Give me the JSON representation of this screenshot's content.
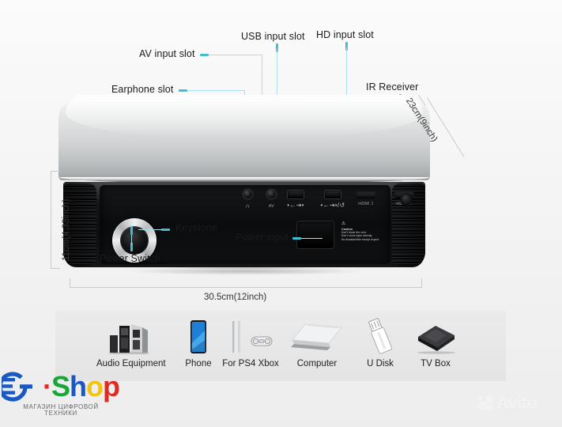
{
  "image": {
    "subject": "Mini LED projector rear/front panel diagram",
    "background_color": "#f4f4f4"
  },
  "callouts": [
    {
      "id": "earphone",
      "label": "Earphone slot",
      "color": "#3fc0d2"
    },
    {
      "id": "av",
      "label": "AV input slot",
      "color": "#3fc0d2"
    },
    {
      "id": "usb",
      "label": "USB input slot",
      "color": "#3fc0d2"
    },
    {
      "id": "hd",
      "label": "HD input slot",
      "color": "#3fc0d2"
    },
    {
      "id": "ir",
      "label": "IR Receiver",
      "color": "#3fc0d2"
    },
    {
      "id": "keystone",
      "label": "Keystone",
      "color": "#3fc0d2"
    },
    {
      "id": "power_switch",
      "label": "Power Switch",
      "color": "#3fc0d2"
    },
    {
      "id": "power_input",
      "label": "Power input",
      "color": "#3fc0d2"
    }
  ],
  "dimensions": {
    "width": "30.5cm(12inch)",
    "height": "11cm(4.33inch)",
    "depth": "23cm(9inch)"
  },
  "ports": [
    {
      "id": "earphone",
      "label": "∩",
      "type": "jack"
    },
    {
      "id": "av",
      "label": "AV",
      "type": "jack"
    },
    {
      "id": "usb1",
      "label": "•←⇥•",
      "type": "usb"
    },
    {
      "id": "usb2",
      "label": "•←⇥•/↺",
      "type": "usb"
    },
    {
      "id": "hdmi1",
      "label": "HDMI 1",
      "type": "hdmi"
    },
    {
      "id": "hdmi2",
      "label": "HDMI 2",
      "type": "hdmi"
    }
  ],
  "caution": {
    "heading": "Caution",
    "lines": [
      "Don't block the vent.",
      "Don't shoot eyes directly.",
      "No disassemble except expert."
    ]
  },
  "accessories": [
    {
      "id": "audio",
      "label": "Audio Equipment"
    },
    {
      "id": "phone",
      "label": "Phone"
    },
    {
      "id": "console",
      "label": "For PS4 Xbox"
    },
    {
      "id": "computer",
      "label": "Computer"
    },
    {
      "id": "udisk",
      "label": "U Disk"
    },
    {
      "id": "tvbox",
      "label": "TV Box"
    }
  ],
  "watermarks": {
    "shop": {
      "g": "G",
      "dot": "·",
      "s": "S",
      "h": "h",
      "o": "o",
      "p": "p",
      "tagline_line1": "МАГАЗИН ЦИФРОВОЙ",
      "tagline_line2": "ТЕХНИКИ",
      "colors": {
        "g": "#1a58c4",
        "dot": "#e02b20",
        "s": "#17a637",
        "h": "#1a58c4",
        "o": "#f2c40d",
        "p": "#e02b20"
      }
    },
    "avito": {
      "text": "Avito"
    }
  }
}
